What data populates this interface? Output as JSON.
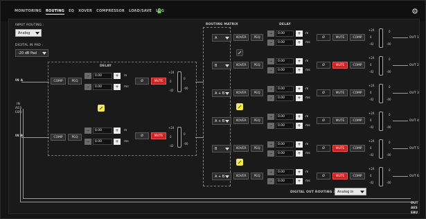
{
  "menu": {
    "items": [
      "MONITORING",
      "ROUTING",
      "EQ",
      "XOVER",
      "COMPRESSOR",
      "LOAD/SAVE",
      "LOG"
    ],
    "active_index": 1
  },
  "input_routing": {
    "label": "INPUT ROUTING :",
    "value": "Analog"
  },
  "digital_in_pad": {
    "label": "DIGITAL IN PAD :",
    "value": "-20 dB Pad"
  },
  "inputs": {
    "in_a_label": "IN A",
    "in_b_label": "IN B",
    "in_aes_label_line1": "IN",
    "in_aes_label_line2": "AES",
    "in_aes_label_line3": "EBU",
    "delay_label": "DELAY",
    "comp_label": "COMP",
    "peq_label": "PEQ",
    "delay_m": "0.00",
    "delay_ms": "0.00",
    "unit_m": "m",
    "unit_ms": "ms",
    "phase_label": "Ø",
    "mute_label": "MUTE",
    "scale_top": "+24",
    "scale_mid": "0",
    "scale_bottom": "-42",
    "scale_value": "-00"
  },
  "routing_matrix": {
    "label": "ROUTING MATRIX",
    "delay_label": "DELAY",
    "rows": [
      {
        "source": "A",
        "out": "OUT 1",
        "mute_on": false
      },
      {
        "source": "B",
        "out": "OUT 2",
        "mute_on": true
      },
      {
        "source": "A + B",
        "out": "OUT 3",
        "mute_on": false
      },
      {
        "source": "A + B",
        "out": "OUT 4",
        "mute_on": false
      },
      {
        "source": "B",
        "out": "OUT 5",
        "mute_on": true
      },
      {
        "source": "A + B",
        "out": "OUT 6",
        "mute_on": true
      }
    ],
    "xover_label": "XOVER",
    "peq_label": "PEQ",
    "comp_label": "COMP",
    "mute_label": "MUTE",
    "phase_label": "Ø",
    "delay_m": "0.00",
    "delay_ms": "0.00",
    "unit_m": "m",
    "unit_ms": "ms",
    "scale_top": "+24",
    "scale_mid": "0",
    "scale_bottom": "-42",
    "scale_value": "0",
    "scale_value_low": "-00"
  },
  "digital_out": {
    "label": "DIGITAL OUT ROUTING :",
    "value": "Analog in",
    "out_line1": "OUT",
    "out_line2": "AES",
    "out_line3": "EBU"
  },
  "colors": {
    "background": "#151515",
    "mute_active": "#cc2222",
    "link_yellow": "#f6e85a",
    "meter_green": "#3cd45a"
  }
}
